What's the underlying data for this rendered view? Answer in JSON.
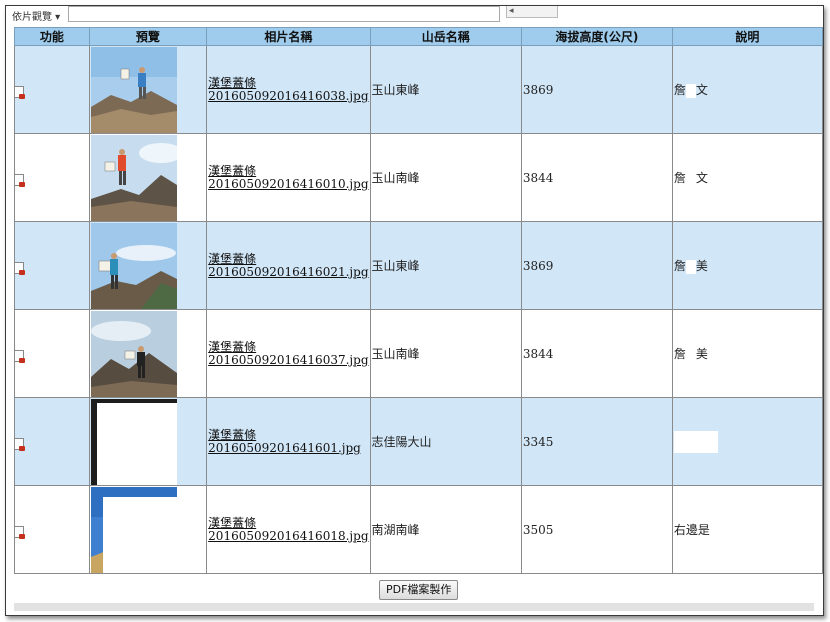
{
  "topbar": {
    "prefix_text": "依片觀覽 ▾",
    "search_placeholder": "",
    "go_label": "◂"
  },
  "columns": [
    "功能",
    "預覽",
    "相片名稱",
    "山岳名稱",
    "海拔高度(公尺)",
    "說明"
  ],
  "rows": [
    {
      "file_line1": "漢堡蓋條",
      "file_line2": "20160509201641​6038.jpg",
      "mountain": "玉山東峰",
      "elevation": "3869",
      "desc_a": "詹",
      "desc_b": "文",
      "scene": "east"
    },
    {
      "file_line1": "漢堡蓋條",
      "file_line2": "201605092016416010.jpg",
      "mountain": "玉山南峰",
      "elevation": "3844",
      "desc_a": "詹",
      "desc_b": "文",
      "scene": "south"
    },
    {
      "file_line1": "漢堡蓋條",
      "file_line2": "201605092016416021.jpg",
      "mountain": "玉山東峰",
      "elevation": "3869",
      "desc_a": "詹",
      "desc_b": "美",
      "scene": "east2"
    },
    {
      "file_line1": "漢堡蓋條",
      "file_line2": "201605092016416037.jpg",
      "mountain": "玉山南峰",
      "elevation": "3844",
      "desc_a": "詹",
      "desc_b": "美",
      "scene": "south2"
    },
    {
      "file_line1": "漢堡蓋條",
      "file_line2": "20160509201641601.jpg",
      "mountain": "志佳陽大山",
      "elevation": "3345",
      "desc_a": "",
      "desc_b": "",
      "scene": "dark"
    },
    {
      "file_line1": "漢堡蓋條",
      "file_line2": "201605092016416018.jpg",
      "mountain": "南湖南峰",
      "elevation": "3505",
      "desc_a": "右邊是",
      "desc_b": "",
      "scene": "sky"
    }
  ],
  "footer": {
    "pdf_button_label": "PDF檔案製作"
  }
}
